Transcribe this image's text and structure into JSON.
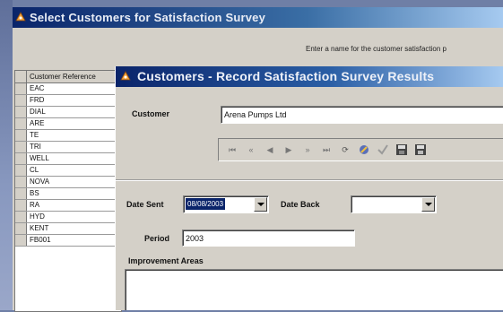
{
  "back_window": {
    "title": "Select Customers for Satisfaction Survey",
    "instruction": "Enter a name for the customer satisfaction p",
    "list": {
      "header": "Customer Reference",
      "rows": [
        "EAC",
        "FRD",
        "DIAL",
        "ARE",
        "TE",
        "TRI",
        "WELL",
        "CL",
        "NOVA",
        "BS",
        "RA",
        "HYD",
        "KENT",
        "FB001"
      ]
    }
  },
  "front_window": {
    "title": "Customers - Record Satisfaction Survey Results",
    "customer_label": "Customer",
    "customer_value": "Arena Pumps Ltd",
    "date_sent_label": "Date Sent",
    "date_sent_value": "08/08/2003",
    "date_back_label": "Date Back",
    "date_back_value": "",
    "period_label": "Period",
    "period_value": "2003",
    "improvement_label": "Improvement Areas"
  },
  "navigator": {
    "first": "⏮",
    "prior_page": "«",
    "prior": "◀",
    "next": "▶",
    "next_page": "»",
    "last": "⏭",
    "refresh": "⟳"
  },
  "colors": {
    "titlebar_start": "#0a246a",
    "titlebar_end": "#a6caf0",
    "window_bg": "#d4d0c8",
    "selection": "#0a246a"
  }
}
